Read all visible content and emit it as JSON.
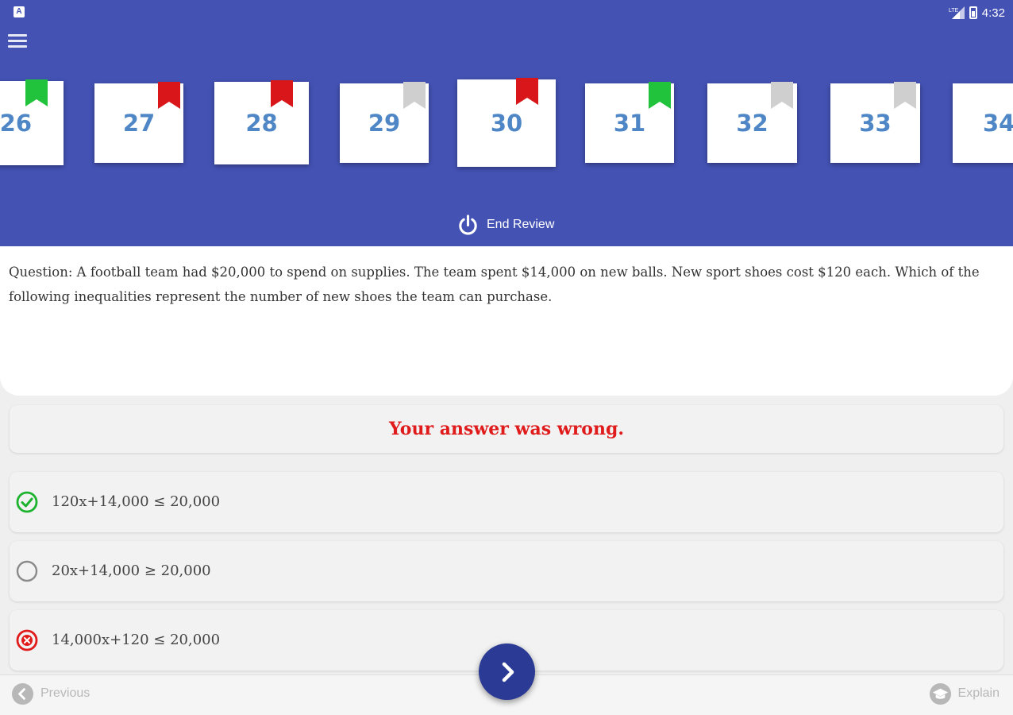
{
  "status_bar": {
    "time": "4:32"
  },
  "colors": {
    "header": "#4452b4",
    "card_number": "#4e86c6",
    "ribbon_green": "#22c33c",
    "ribbon_red": "#d9161a",
    "ribbon_gray": "#cfcfcf",
    "wrong_text": "#e01b1b",
    "correct_icon": "#1db32f",
    "fab": "#2b3a94"
  },
  "question_nav": {
    "cards": [
      {
        "number": "26",
        "ribbon": "green"
      },
      {
        "number": "27",
        "ribbon": "red"
      },
      {
        "number": "28",
        "ribbon": "red"
      },
      {
        "number": "29",
        "ribbon": "gray"
      },
      {
        "number": "30",
        "ribbon": "red",
        "current": true
      },
      {
        "number": "31",
        "ribbon": "green"
      },
      {
        "number": "32",
        "ribbon": "gray"
      },
      {
        "number": "33",
        "ribbon": "gray"
      },
      {
        "number": "34",
        "ribbon": "gray"
      }
    ],
    "end_review_label": "End Review"
  },
  "question": {
    "text": "Question: A football team had $20,000 to spend on supplies. The team spent $14,000 on new balls. New sport shoes cost $120 each. Which of the following inequalities represent the number of new shoes the team can purchase."
  },
  "result": {
    "message": "Your answer was wrong."
  },
  "options": [
    {
      "text": "120x+14,000 ≤ 20,000",
      "state": "correct",
      "icon": "check-circle-icon"
    },
    {
      "text": "20x+14,000 ≥ 20,000",
      "state": "none",
      "icon": "empty-circle-icon"
    },
    {
      "text": "14,000x+120 ≤ 20,000",
      "state": "wrong",
      "icon": "x-circle-icon"
    }
  ],
  "bottom_bar": {
    "previous_label": "Previous",
    "explain_label": "Explain"
  }
}
